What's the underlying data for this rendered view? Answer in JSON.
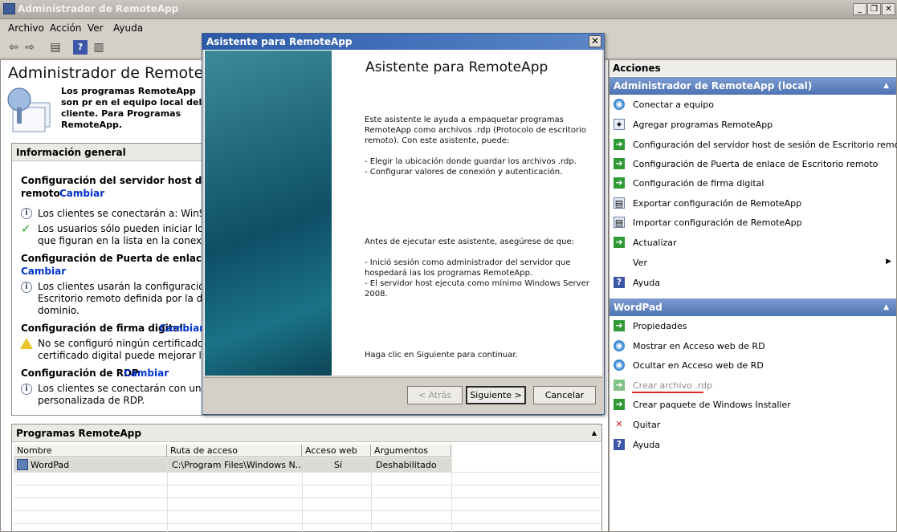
{
  "window": {
    "title": "Administrador de RemoteApp"
  },
  "menu": [
    "Archivo",
    "Acción",
    "Ver",
    "Ayuda"
  ],
  "left": {
    "title": "Administrador de RemoteApp",
    "description": "Los programas RemoteApp son pr en el equipo local del cliente. Para Programas RemoteApp.",
    "info_header": "Información general",
    "sections": {
      "host_title_1": "Configuración del servidor host de sesió",
      "host_title_2": "remoto",
      "host_link": "Cambiar",
      "host_line1": "Los clientes se conectarán a: WinServer",
      "host_line2a": "Los usuarios sólo pueden iniciar los pro",
      "host_line2b": "que figuran en la lista en la conexión in",
      "gw_title": "Configuración de Puerta de enlace de Esc",
      "gw_link": "Cambiar",
      "gw_line1": "Los clientes usarán la configuración de",
      "gw_line2": "Escritorio remoto definida por la direct",
      "gw_line3": "dominio.",
      "sig_title": "Configuración de firma digital",
      "sig_link": "Cambiar",
      "sig_line1": "No se configuró ningún certificado dig",
      "sig_line2": "certificado digital puede mejorar la seg",
      "rdp_title": "Configuración de RDP",
      "rdp_link": "Cambiar",
      "rdp_line1": "Los clientes se conectarán con una cor",
      "rdp_line2": "personalizada de RDP."
    },
    "programs": {
      "header": "Programas RemoteApp",
      "columns": [
        "Nombre",
        "Ruta de acceso",
        "Acceso web ...",
        "Argumentos"
      ],
      "rows": [
        {
          "name": "WordPad",
          "path": "C:\\Program Files\\Windows N...",
          "web": "Sí",
          "args": "Deshabilitado"
        }
      ]
    }
  },
  "actions": {
    "header": "Acciones",
    "group1": "Administrador de RemoteApp (local)",
    "items1": [
      "Conectar a equipo",
      "Agregar programas RemoteApp",
      "Configuración del servidor host de sesión de Escritorio remoto",
      "Configuración de Puerta de enlace de Escritorio remoto",
      "Configuración de firma digital",
      "Exportar configuración de RemoteApp",
      "Importar configuración de RemoteApp",
      "Actualizar",
      "Ver",
      "Ayuda"
    ],
    "group2": "WordPad",
    "items2": [
      "Propiedades",
      "Mostrar en Acceso web de RD",
      "Ocultar en Acceso web de RD",
      "Crear archivo .rdp",
      "Crear paquete de Windows Installer",
      "Quitar",
      "Ayuda"
    ]
  },
  "dialog": {
    "title": "Asistente para RemoteApp",
    "heading": "Asistente para RemoteApp",
    "p1": "Este asistente le ayuda a empaquetar programas RemoteApp como archivos .rdp (Protocolo de escritorio remoto). Con este asistente, puede:",
    "b1": "- Elegir la ubicación donde guardar los archivos .rdp.",
    "b2": "- Configurar valores de conexión y autenticación.",
    "p2": "Antes de ejecutar este asistente, asegúrese de que:",
    "b3": "- Inició sesión como administrador del servidor que hospedará las los programas RemoteApp.",
    "b4": "- El servidor host ejecuta como mínimo Windows Server 2008.",
    "p3": "Haga clic en Siguiente para continuar.",
    "back": "< Atrás",
    "next": "Siguiente >",
    "cancel": "Cancelar"
  }
}
